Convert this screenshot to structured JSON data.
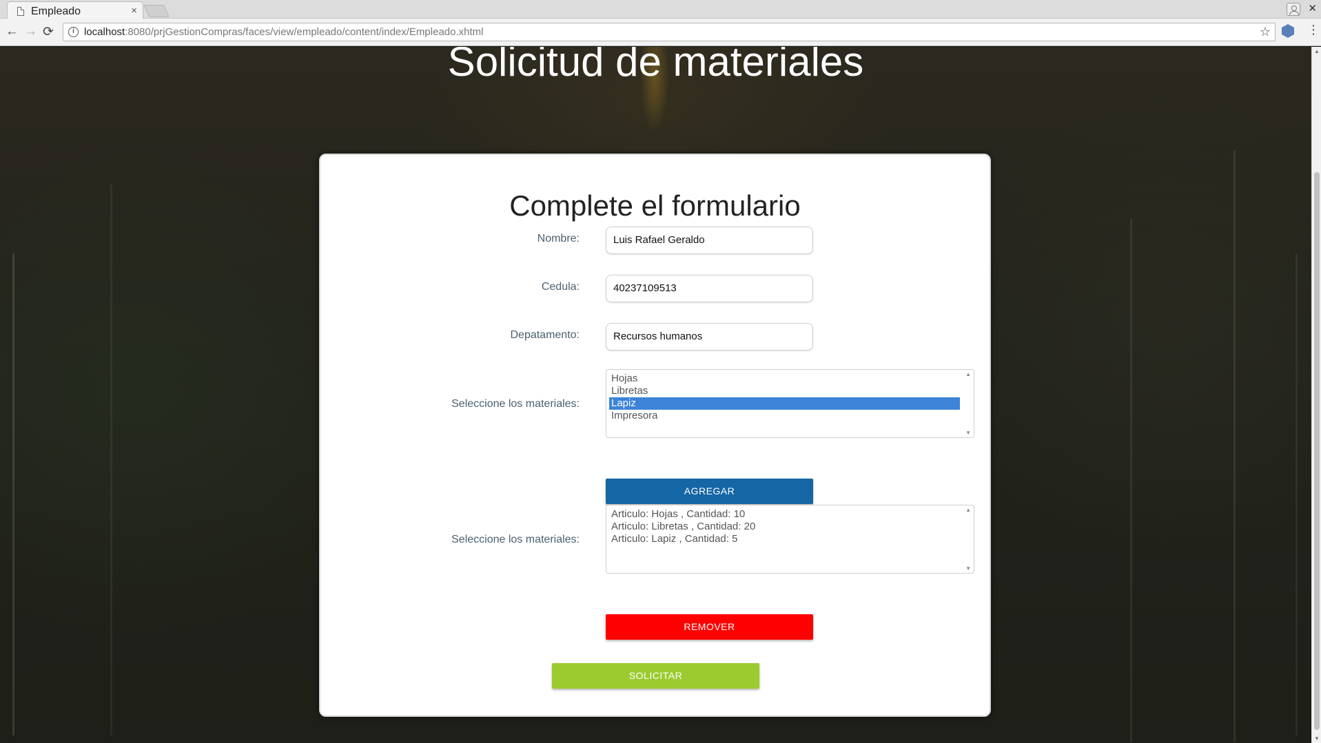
{
  "browser": {
    "tab_title": "Empleado",
    "tab_close": "×",
    "url_host": "localhost",
    "url_rest": ":8080/prjGestionCompras/faces/view/empleado/content/index/Empleado.xhtml",
    "back_glyph": "←",
    "forward_glyph": "→",
    "reload_glyph": "⟳",
    "star_glyph": "☆",
    "menu_glyph": "⋮",
    "close_window_glyph": "✕",
    "info_glyph": "i"
  },
  "page": {
    "title": "Solicitud de materiales"
  },
  "form": {
    "title": "Complete el formulario",
    "nombre_label": "Nombre:",
    "nombre_value": "Luis Rafael Geraldo",
    "cedula_label": "Cedula:",
    "cedula_value": "40237109513",
    "departamento_label": "Depatamento:",
    "departamento_value": "Recursos humanos",
    "materiales_label": "Seleccione los materiales:",
    "materiales_options": [
      "Hojas",
      "Libretas",
      "Lapiz",
      "Impresora"
    ],
    "materiales_selected": "Lapiz",
    "agregar_label": "AGREGAR",
    "seleccionados_label": "Seleccione los materiales:",
    "seleccionados_items": [
      "Articulo: Hojas , Cantidad: 10",
      "Articulo: Libretas , Cantidad: 20",
      "Articulo: Lapiz , Cantidad: 5"
    ],
    "remover_label": "REMOVER",
    "solicitar_label": "SOLICITAR"
  },
  "colors": {
    "agregar": "#1566a5",
    "remover": "#ff0000",
    "solicitar": "#9ccb2f",
    "selected_option": "#3c84d8"
  }
}
